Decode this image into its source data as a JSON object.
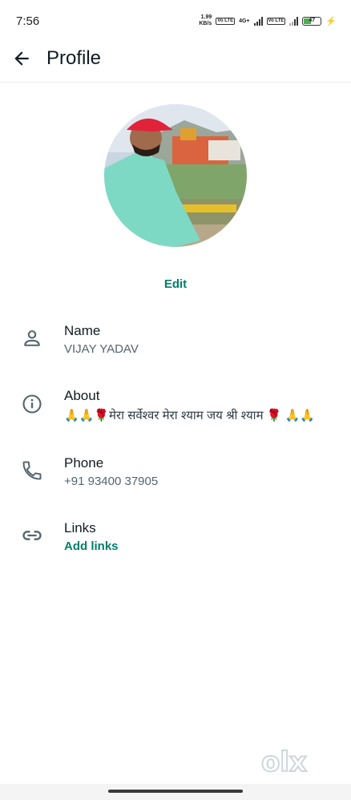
{
  "status_bar": {
    "time": "7:56",
    "speed_value": "1.99",
    "speed_unit": "KB/s",
    "network_type": "4G+",
    "volte1": "Vo LTE",
    "volte2": "Vo LTE",
    "battery_level": "47"
  },
  "header": {
    "title": "Profile"
  },
  "profile": {
    "edit_label": "Edit"
  },
  "fields": [
    {
      "label": "Name",
      "value": "VIJAY YADAV",
      "icon": "person-icon"
    },
    {
      "label": "About",
      "value": "🙏🙏🌹मेरा सर्वेश्वर मेरा श्याम जय श्री श्याम 🌹 🙏🙏",
      "icon": "info-icon"
    },
    {
      "label": "Phone",
      "value": "+91 93400 37905",
      "icon": "phone-icon"
    },
    {
      "label": "Links",
      "value": "Add links",
      "icon": "link-icon"
    }
  ],
  "watermark": "olx",
  "colors": {
    "accent": "#008069",
    "text": "#111b21",
    "secondary": "#54656f"
  }
}
